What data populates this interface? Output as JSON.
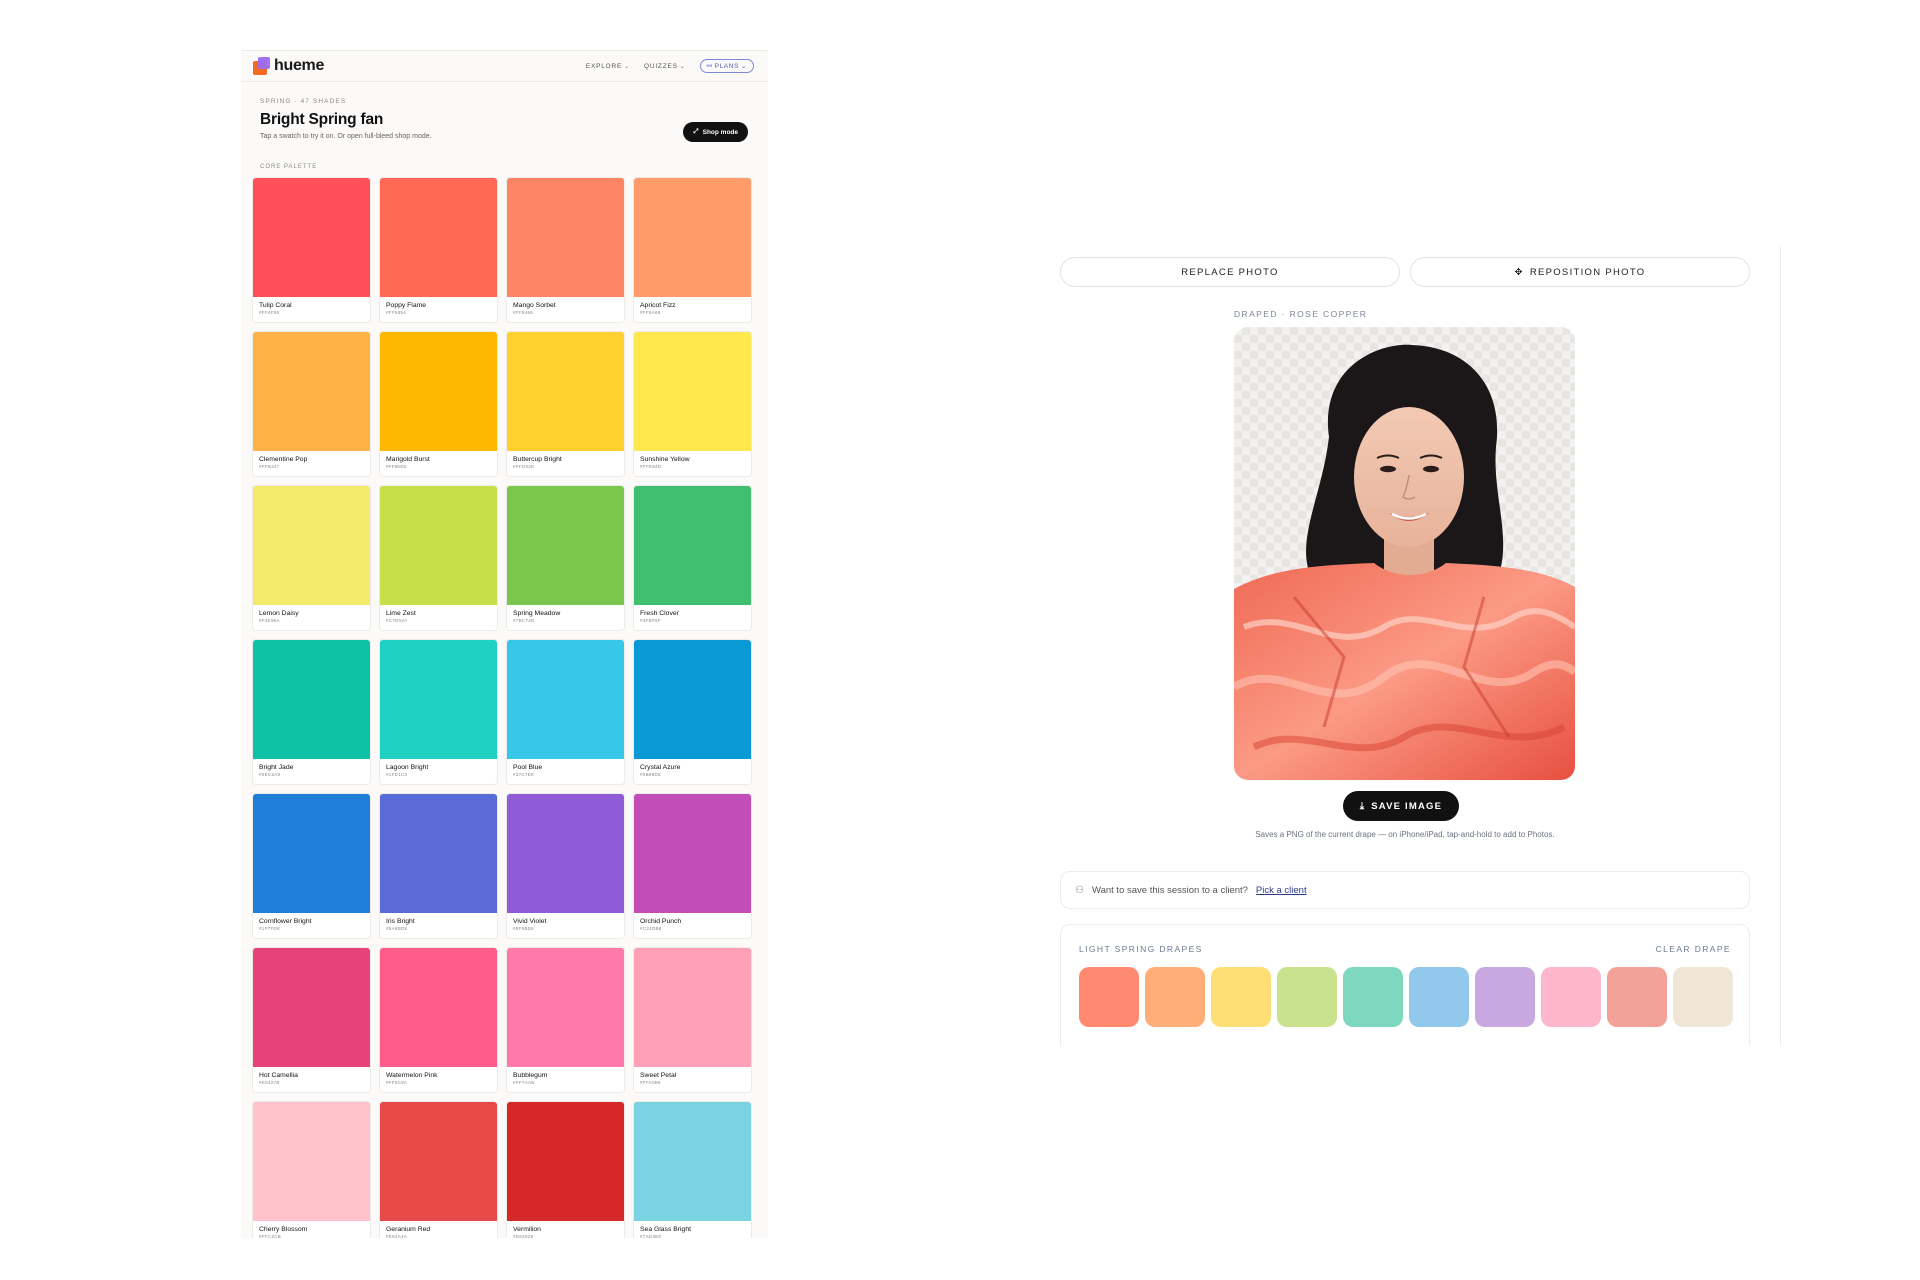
{
  "app": {
    "logo_text": "hueme",
    "nav": [
      {
        "label": "EXPLORE"
      },
      {
        "label": "QUIZZES"
      }
    ],
    "plans_label": "PLANS"
  },
  "palette_page": {
    "eyebrow": "SPRING · 47 SHADES",
    "title": "Bright Spring fan",
    "subtitle": "Tap a swatch to try it on. Or open full-bleed shop mode.",
    "shop_mode_label": "Shop mode",
    "section_label": "CORE PALETTE",
    "swatches": [
      {
        "name": "Tulip Coral",
        "hex": "#FF4F58",
        "color": "#FF4F58"
      },
      {
        "name": "Poppy Flame",
        "hex": "#FF6854",
        "color": "#FF6854"
      },
      {
        "name": "Mango Sorbet",
        "hex": "#FF8466",
        "color": "#FF8466"
      },
      {
        "name": "Apricot Fizz",
        "hex": "#FF9A69",
        "color": "#FF9A69"
      },
      {
        "name": "Clementine Pop",
        "hex": "#FFB347",
        "color": "#FFB347"
      },
      {
        "name": "Marigold Burst",
        "hex": "#FFB800",
        "color": "#FFB800"
      },
      {
        "name": "Buttercup Bright",
        "hex": "#FFD02E",
        "color": "#FFD02E"
      },
      {
        "name": "Sunshine Yellow",
        "hex": "#FFE84D",
        "color": "#FFE84D"
      },
      {
        "name": "Lemon Daisy",
        "hex": "#F3E96A",
        "color": "#F3E96A"
      },
      {
        "name": "Lime Zest",
        "hex": "#C7E04A",
        "color": "#C7E04A"
      },
      {
        "name": "Spring Meadow",
        "hex": "#7BC74D",
        "color": "#7BC74D"
      },
      {
        "name": "Fresh Clover",
        "hex": "#3FBF6F",
        "color": "#3FBF6F"
      },
      {
        "name": "Bright Jade",
        "hex": "#0EC2A8",
        "color": "#0EC2A8"
      },
      {
        "name": "Lagoon Bright",
        "hex": "#1FD1C3",
        "color": "#1FD1C3"
      },
      {
        "name": "Pool Blue",
        "hex": "#37C7E8",
        "color": "#37C7E8"
      },
      {
        "name": "Crystal Azure",
        "hex": "#0B99D6",
        "color": "#0B99D6"
      },
      {
        "name": "Cornflower Bright",
        "hex": "#1F7FD8",
        "color": "#1F7FD8"
      },
      {
        "name": "Iris Bright",
        "hex": "#5A6BD8",
        "color": "#5A6BD8"
      },
      {
        "name": "Vivid Violet",
        "hex": "#8F5BD6",
        "color": "#8F5BD6"
      },
      {
        "name": "Orchid Punch",
        "hex": "#C24DB8",
        "color": "#C24DB8"
      },
      {
        "name": "Hot Camellia",
        "hex": "#E8427B",
        "color": "#E8427B"
      },
      {
        "name": "Watermelon Pink",
        "hex": "#FF5C8A",
        "color": "#FF5C8A"
      },
      {
        "name": "Bubblegum",
        "hex": "#FF7AAB",
        "color": "#FF7AAB"
      },
      {
        "name": "Sweet Petal",
        "hex": "#FFA0B6",
        "color": "#FFA0B6"
      },
      {
        "name": "Cherry Blossom",
        "hex": "#FFC2CB",
        "color": "#FFC2CB"
      },
      {
        "name": "Geranium Red",
        "hex": "#E84A4A",
        "color": "#E84A4A"
      },
      {
        "name": "Vermilion",
        "hex": "#D62828",
        "color": "#D62828"
      },
      {
        "name": "Sea Glass Bright",
        "hex": "#7AD3E0",
        "color": "#7AD3E0"
      }
    ]
  },
  "drape_tool": {
    "replace_photo_label": "REPLACE PHOTO",
    "reposition_photo_label": "REPOSITION PHOTO",
    "draped_label": "DRAPED · ROSE COPPER",
    "save_image_label": "SAVE IMAGE",
    "save_note": "Saves a PNG of the current drape — on iPhone/iPad, tap-and-hold to add to Photos.",
    "client_prompt": "Want to save this session to a client?",
    "client_link": "Pick a client",
    "drapes_title": "LIGHT SPRING DRAPES",
    "clear_drape_label": "CLEAR DRAPE",
    "drapes": [
      {
        "name": "coral",
        "color": "#FF8A70"
      },
      {
        "name": "apricot",
        "color": "#FFAE78"
      },
      {
        "name": "butter",
        "color": "#FFDE75"
      },
      {
        "name": "lime",
        "color": "#C8E28E"
      },
      {
        "name": "mint",
        "color": "#7ED8C0"
      },
      {
        "name": "sky",
        "color": "#91C8EB"
      },
      {
        "name": "lavender",
        "color": "#C9A8E2"
      },
      {
        "name": "blush",
        "color": "#FDB6CB"
      },
      {
        "name": "rose",
        "color": "#F3A29A"
      },
      {
        "name": "ivory",
        "color": "#EFE6D8"
      }
    ]
  }
}
